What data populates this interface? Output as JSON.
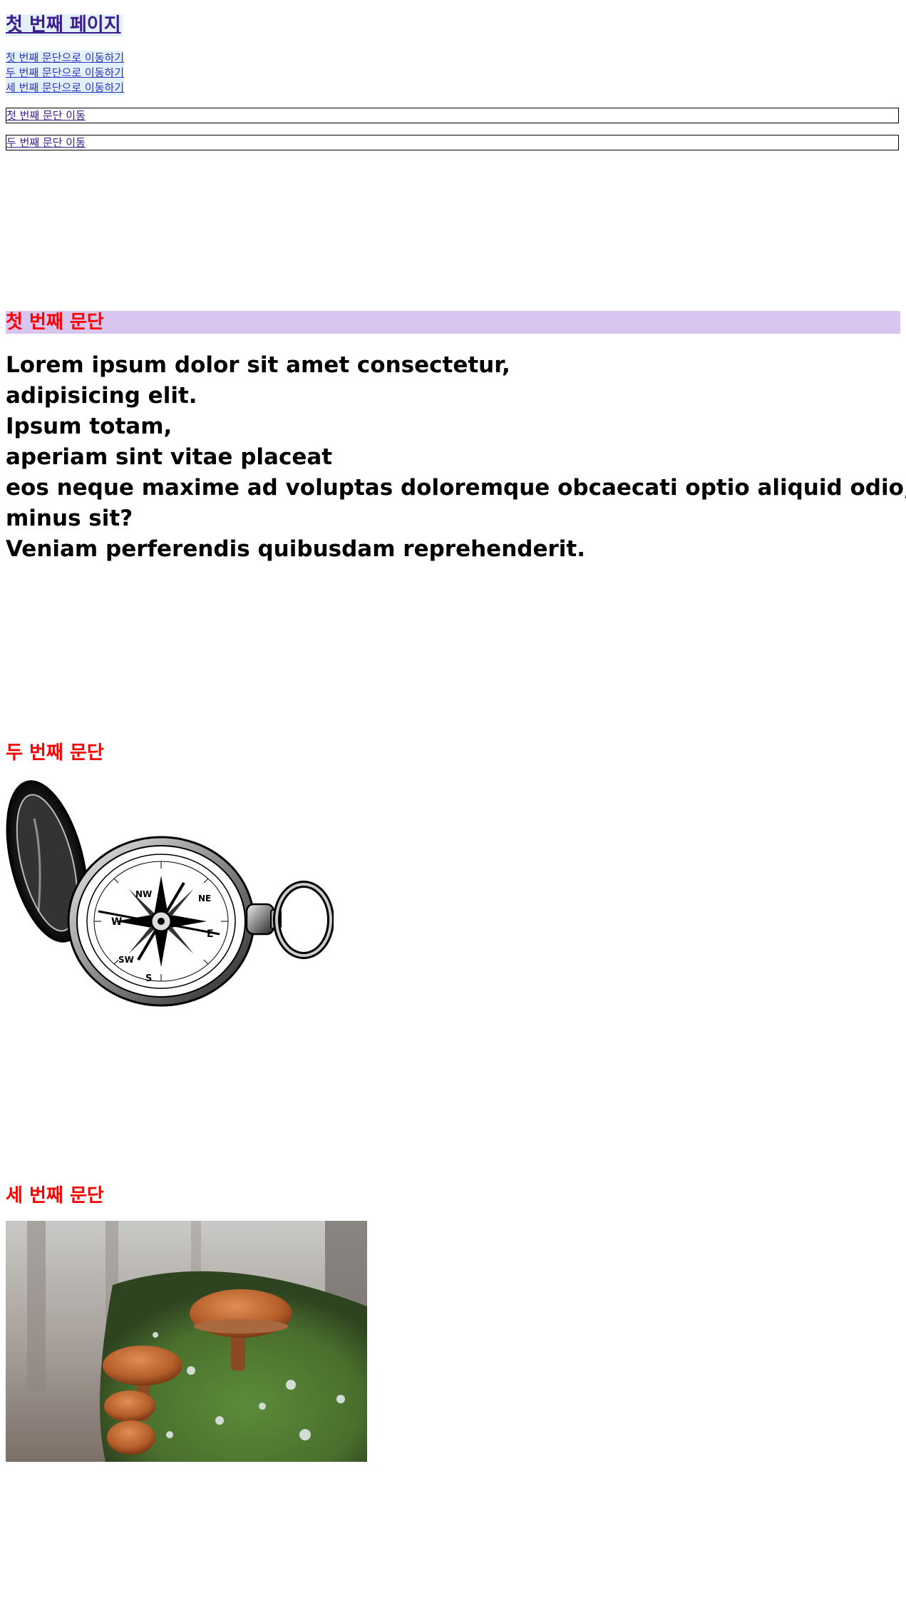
{
  "page": {
    "title": "첫 번째 페이지"
  },
  "jump_nav": [
    {
      "label": "첫 번째 문단으로 이동하기"
    },
    {
      "label": "두 번째 문단으로 이동하기"
    },
    {
      "label": "세 번째 문단으로 이동하기"
    }
  ],
  "move_rows": [
    {
      "label": "첫 번째 문단 이동"
    },
    {
      "label": "두 번째 문단 이동"
    }
  ],
  "sections": [
    {
      "heading": "첫 번째 문단",
      "lines": [
        "Lorem ipsum dolor sit amet consectetur,",
        "adipisicing elit.",
        "Ipsum totam,",
        "aperiam sint vitae placeat",
        "eos neque maxime ad voluptas doloremque obcaecati optio aliquid odio,",
        "minus sit?",
        "Veniam perferendis quibusdam reprehenderit."
      ]
    },
    {
      "heading": "두 번째 문단",
      "image": "compass-illustration"
    },
    {
      "heading": "세 번째 문단",
      "image": "mushroom-photo"
    }
  ],
  "colors": {
    "heading_red": "#ff0000",
    "section1_bg": "#d9c5ef",
    "link_bg": "#e3f0f8",
    "link_blue": "#2a35c8",
    "visited_purple": "#3a1d8f"
  }
}
